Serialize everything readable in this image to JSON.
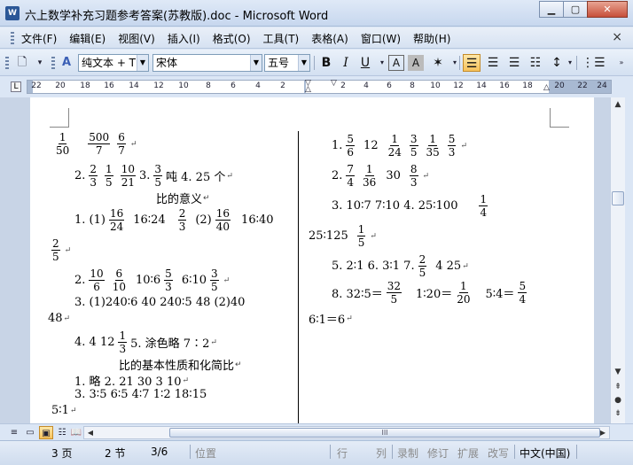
{
  "window": {
    "app_icon": "W",
    "title": "六上数学补充习题参考答案(苏教版).doc - Microsoft Word",
    "minimize_glyph": "▁",
    "maximize_glyph": "▢",
    "close_glyph": "✕"
  },
  "menu": {
    "items": [
      "文件(F)",
      "编辑(E)",
      "视图(V)",
      "插入(I)",
      "格式(O)",
      "工具(T)",
      "表格(A)",
      "窗口(W)",
      "帮助(H)"
    ],
    "close_glyph": "×"
  },
  "toolbar": {
    "style_value": "纯文本 + T",
    "font_value": "宋体",
    "size_value": "五号",
    "bold": "B",
    "italic": "I",
    "underline": "U"
  },
  "ruler": {
    "tab_glyph": "L",
    "ticks": [
      "22",
      "20",
      "18",
      "16",
      "14",
      "12",
      "10",
      "8",
      "6",
      "4",
      "2",
      "2",
      "4",
      "6",
      "8",
      "10",
      "12",
      "14",
      "16",
      "18",
      "20",
      "22",
      "24"
    ]
  },
  "document": {
    "left": {
      "l1_fracs": [
        [
          "1",
          "50"
        ],
        [
          "500",
          "7"
        ],
        [
          "6",
          "7"
        ]
      ],
      "l2_prefix": "2.",
      "l2_fracs": [
        [
          "2",
          "3"
        ],
        [
          "1",
          "5"
        ],
        [
          "10",
          "21"
        ]
      ],
      "l2_mid": "3.",
      "l2_frac4": [
        "3",
        "5"
      ],
      "l2_suffix": "吨   4. 25 个",
      "heading1": "比的意义",
      "l4_a": "1.  (1)",
      "l4_f1": [
        "16",
        "24"
      ],
      "l4_b": "16∶24",
      "l4_f2": [
        "2",
        "3"
      ],
      "l4_c": "(2)",
      "l4_f3": [
        "16",
        "40"
      ],
      "l4_d": "16∶40",
      "l5_frac": [
        "2",
        "5"
      ],
      "l6_prefix": "2.",
      "l6_f1": [
        "10",
        "6"
      ],
      "l6_f2": [
        "6",
        "10"
      ],
      "l6_mid": "10∶6",
      "l6_f3": [
        "5",
        "3"
      ],
      "l6_mid2": "6∶10",
      "l6_f4": [
        "3",
        "5"
      ],
      "l7": "3.  (1)240∶6   40    240∶5    48    (2)40",
      "l8": "48",
      "l9_a": "4. 4    12",
      "l9_f": [
        "1",
        "3"
      ],
      "l9_b": "5.  涂色略    7∶2",
      "heading2": "比的基本性质和化简比",
      "l11": "1.  略    2. 21    30    3    10",
      "l12": "3.  3∶5    6∶5    4∶7    1∶2    18∶15",
      "l13": "5∶1"
    },
    "right": {
      "r1_prefix": "1.",
      "r1_f1": [
        "5",
        "6"
      ],
      "r1_a": "12",
      "r1_f2": [
        "1",
        "24"
      ],
      "r1_f3": [
        "3",
        "5"
      ],
      "r1_f4": [
        "1",
        "35"
      ],
      "r1_f5": [
        "5",
        "3"
      ],
      "r2_prefix": "2.",
      "r2_f1": [
        "7",
        "4"
      ],
      "r2_f2": [
        "1",
        "36"
      ],
      "r2_a": "30",
      "r2_f3": [
        "8",
        "3"
      ],
      "r3": "3.   10∶7     7∶10     4.   25∶100",
      "r3_f": [
        "1",
        "4"
      ],
      "r4": "25∶125",
      "r4_f": [
        "1",
        "5"
      ],
      "r5_a": "5. 2∶1    6. 3∶1    7.",
      "r5_f": [
        "2",
        "5"
      ],
      "r5_b": "4    25",
      "r6_a": "8.  32∶5＝",
      "r6_f1": [
        "32",
        "5"
      ],
      "r6_b": "1∶20＝",
      "r6_f2": [
        "1",
        "20"
      ],
      "r6_c": "5∶4＝",
      "r6_f3": [
        "5",
        "4"
      ],
      "r7": "6∶1＝6"
    }
  },
  "hscroll": {
    "thumb_glyph": "III"
  },
  "status": {
    "page": "3 页",
    "section": "2 节",
    "pages": "3/6",
    "position": "位置",
    "line": "行",
    "column": "列",
    "rec": "录制",
    "trk": "修订",
    "ext": "扩展",
    "ovr": "改写",
    "language": "中文(中国)"
  },
  "colors": {
    "chrome": "#dbe6f5",
    "highlight": "#f7c25b"
  }
}
